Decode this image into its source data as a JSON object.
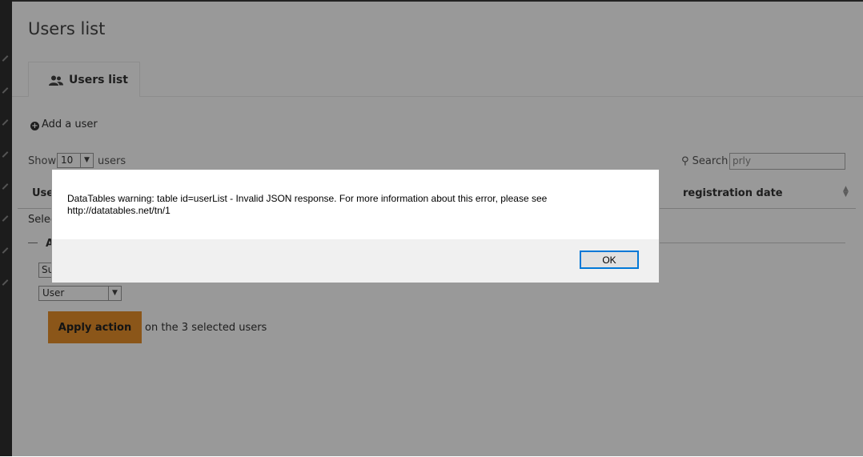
{
  "page": {
    "title": "Users list"
  },
  "tabs": [
    {
      "label": "Users list",
      "icon": "users-icon"
    }
  ],
  "toolbar": {
    "add_user_label": "Add a user"
  },
  "table_controls": {
    "show_label": "Show",
    "page_size": "10",
    "users_label": "users",
    "search_label": "Search",
    "search_value": "prly"
  },
  "table": {
    "columns": [
      {
        "label": "Use"
      },
      {
        "label": "registration date"
      }
    ],
    "select_text": "Selec"
  },
  "actions": {
    "section_letter": "A",
    "action_select_value": "Su",
    "role_select_value": "User",
    "apply_label": "Apply action",
    "apply_suffix": "on the 3 selected users"
  },
  "dialog": {
    "message": "DataTables warning: table id=userList - Invalid JSON response. For more information about this error, please see http://datatables.net/tn/1",
    "ok_label": "OK"
  },
  "colors": {
    "accent": "#e8902a",
    "overlay": "rgba(0,0,0,0.4)",
    "ok_focus": "#0078d7"
  }
}
